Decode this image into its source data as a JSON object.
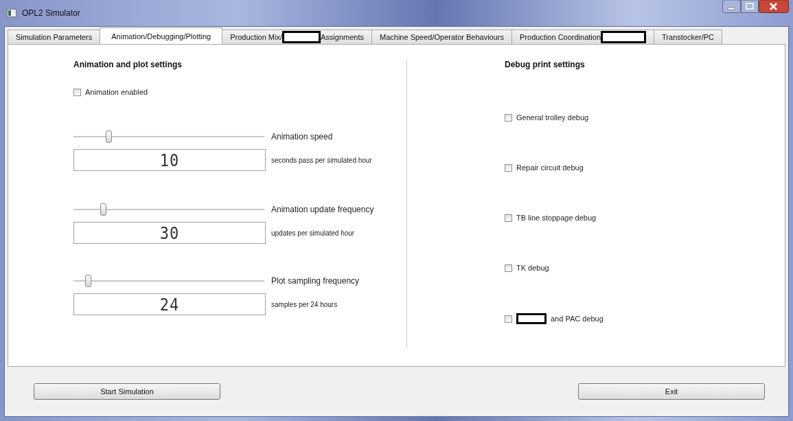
{
  "window": {
    "title": "OPL2 Simulator"
  },
  "tabs": [
    {
      "label": "Simulation Parameters",
      "selected": false
    },
    {
      "label": "Animation/Debugging/Plotting",
      "selected": true
    },
    {
      "label": "Production Mix/",
      "redacted": true,
      "label_after": "Assignments",
      "selected": false
    },
    {
      "label": "Machine Speed/Operator Behaviours",
      "selected": false
    },
    {
      "label": "Production Coordination",
      "redacted": true,
      "selected": false
    },
    {
      "label": "Transtocker/PC",
      "selected": false
    }
  ],
  "animation_panel": {
    "heading": "Animation and plot settings",
    "animation_enabled": {
      "label": "Animation enabled",
      "checked": false
    },
    "settings": [
      {
        "slider_label": "Animation speed",
        "level": 0.17,
        "value": "10",
        "unit": "seconds pass per simulated hour"
      },
      {
        "slider_label": "Animation update frequency",
        "level": 0.14,
        "value": "30",
        "unit": "updates per simulated hour"
      },
      {
        "slider_label": "Plot sampling frequency",
        "level": 0.06,
        "value": "24",
        "unit": "samples per 24 hours"
      }
    ]
  },
  "debug_panel": {
    "heading": "Debug print settings",
    "options": [
      {
        "label": "General trolley debug",
        "checked": false
      },
      {
        "label": "Repair circuit debug",
        "checked": false
      },
      {
        "label": "TB line stoppage debug",
        "checked": false
      },
      {
        "label": "TK debug",
        "checked": false
      },
      {
        "label": "and PAC debug",
        "redacted": true,
        "checked": false
      }
    ]
  },
  "buttons": [
    {
      "label": "Start Simulation"
    },
    {
      "label": "Exit"
    }
  ]
}
